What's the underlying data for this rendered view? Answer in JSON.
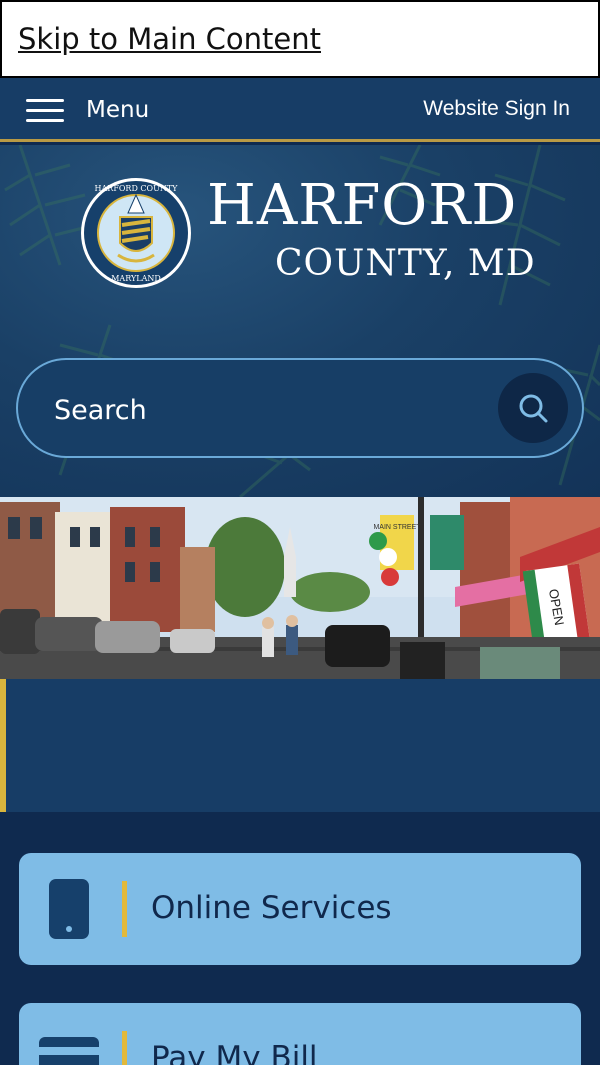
{
  "skip_link": {
    "label": "Skip to Main Content"
  },
  "topbar": {
    "menu_label": "Menu",
    "signin_label": "Website Sign In"
  },
  "logo": {
    "line1": "HARFORD",
    "line2": "COUNTY, MD",
    "seal_top_text": "HARFORD COUNTY",
    "seal_bottom_text": "MARYLAND"
  },
  "search": {
    "placeholder": "Search"
  },
  "photo": {
    "flag_text": "OPEN",
    "banner_text": "MAIN STREET"
  },
  "services": [
    {
      "label": "Online Services",
      "icon": "phone-icon"
    },
    {
      "label": "Pay My Bill",
      "icon": "credit-card-icon"
    }
  ],
  "colors": {
    "navy": "#173d66",
    "dark_navy": "#0f2a4f",
    "gold": "#d8b53d",
    "card_blue": "#7fbce6"
  }
}
